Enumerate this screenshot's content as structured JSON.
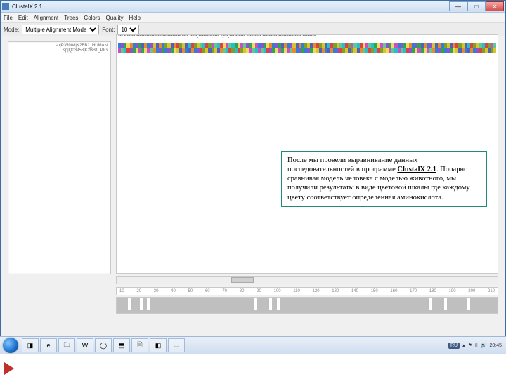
{
  "window": {
    "title": "ClustalX 2.1"
  },
  "winbtns": {
    "min": "—",
    "max": "□",
    "close": "✕"
  },
  "menu": [
    "File",
    "Edit",
    "Alignment",
    "Trees",
    "Colors",
    "Quality",
    "Help"
  ],
  "toolbar": {
    "mode_label": "Mode:",
    "mode_value": "Multiple Alignment Mode",
    "font_label": "Font:",
    "font_value": "10"
  },
  "sequences": {
    "names": [
      "sp|P35908|K2BB1_HUMAN",
      "sp|Q03958|K2BB1_PIG"
    ],
    "consensus": "*** * ***** *************************** **** :****.********:**** *:***.***:****** ********* ********* ************** ********",
    "residue_classes": [
      "cA",
      "cB",
      "cC",
      "cD",
      "cE",
      "cF",
      "cG",
      "cH",
      "cI",
      "cJ",
      "cK",
      "cL"
    ]
  },
  "ruler": {
    "ticks": [
      "10",
      "20",
      "30",
      "40",
      "50",
      "60",
      "70",
      "80",
      "90",
      "100",
      "110",
      "120",
      "130",
      "140",
      "150",
      "160",
      "170",
      "180",
      "190",
      "200",
      "210"
    ]
  },
  "quality_gaps": [
    3,
    6,
    8,
    36,
    40,
    42,
    82,
    86,
    92
  ],
  "note_text_pre": "После мы провели выравнивание данных последовательностей в программе ",
  "note_prog": "ClustalX 2.1",
  "note_text_post": ".  Попарно сравнивая модель человека с моделью животного, мы получили результаты в виде цветовой шкалы где каждому цвету соответствует определенная аминокислота.",
  "tray": {
    "lang": "RU",
    "time": "20:45"
  },
  "task_icons": [
    "◨",
    "e",
    "🗀",
    "W",
    "◯",
    "⬒",
    "🗎",
    "◧",
    "▭"
  ]
}
